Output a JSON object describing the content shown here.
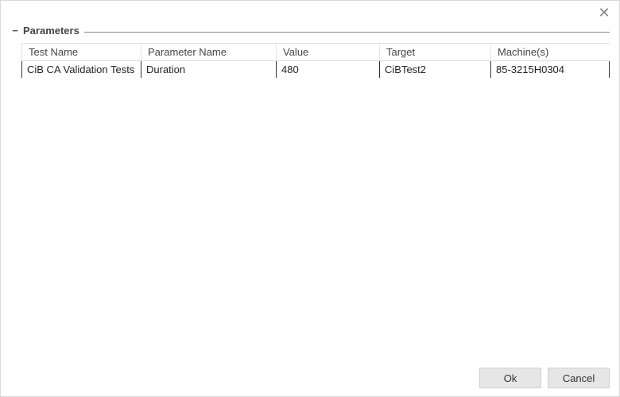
{
  "group": {
    "title": "Parameters",
    "toggle_glyph": "−"
  },
  "table": {
    "headers": {
      "test_name": "Test Name",
      "parameter_name": "Parameter Name",
      "value": "Value",
      "target": "Target",
      "machines": "Machine(s)"
    },
    "rows": [
      {
        "test_name": "CiB CA Validation Tests",
        "parameter_name": "Duration",
        "value": "480",
        "target": "CiBTest2",
        "machines": "85-3215H0304"
      }
    ]
  },
  "buttons": {
    "ok": "Ok",
    "cancel": "Cancel"
  },
  "close_glyph": "✕"
}
